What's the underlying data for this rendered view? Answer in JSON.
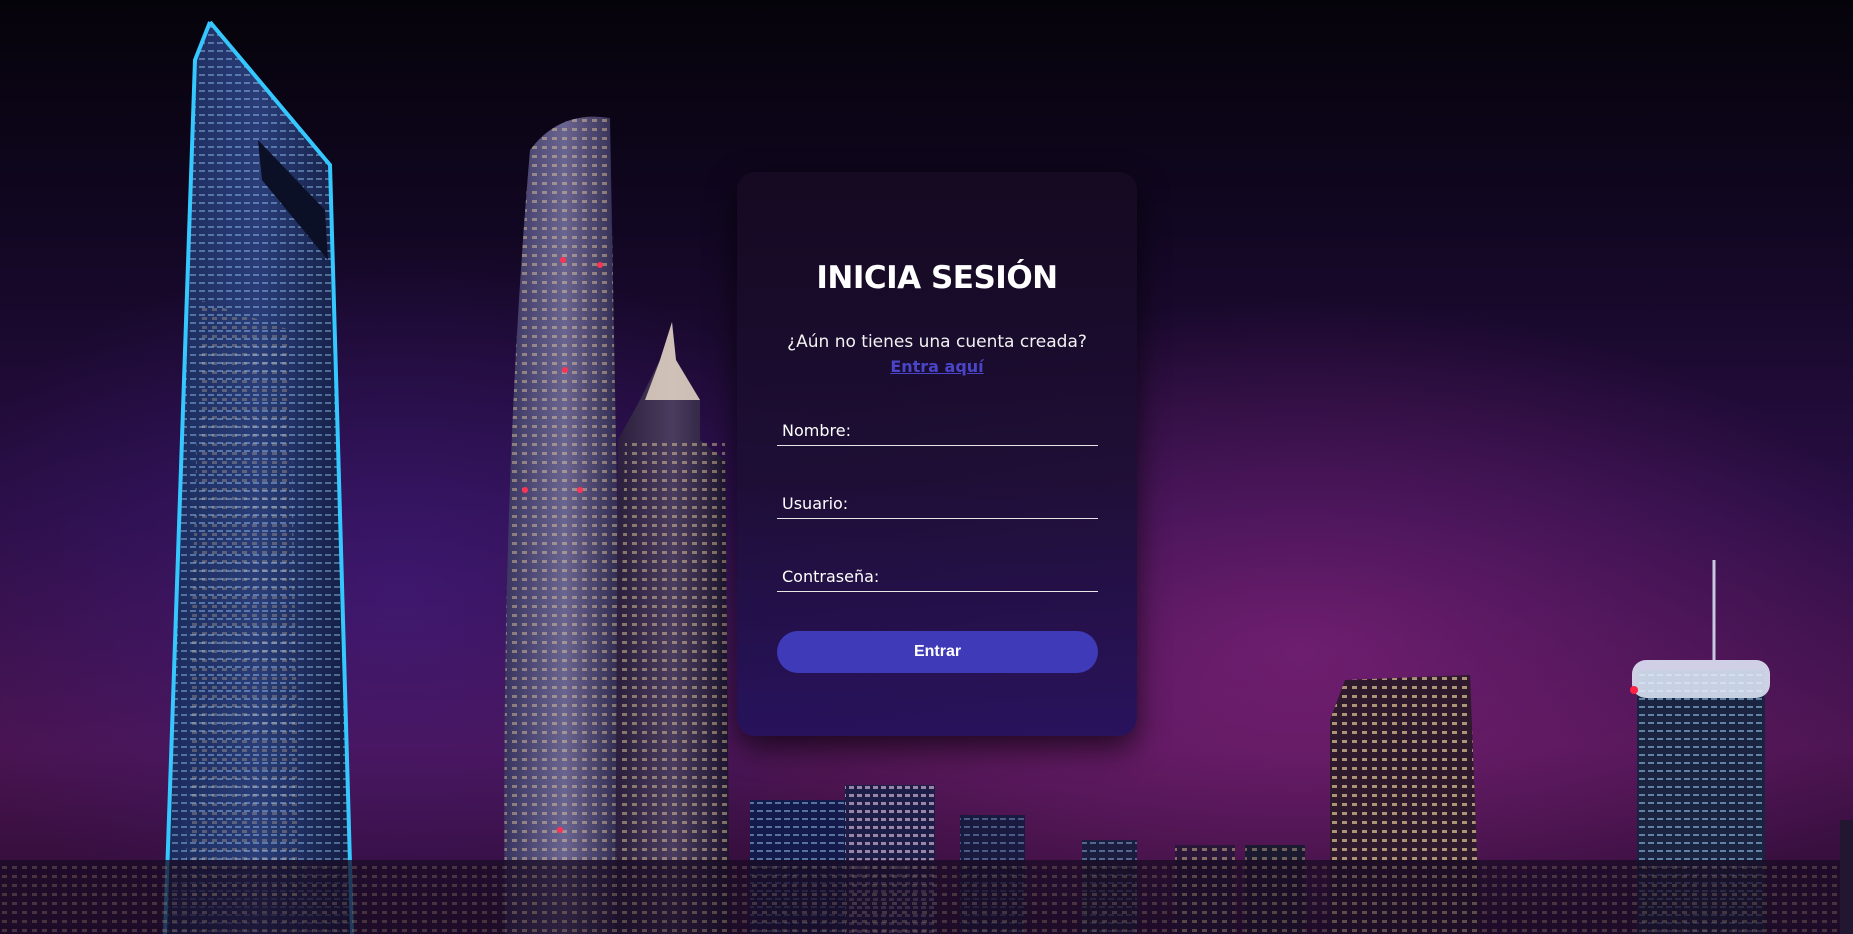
{
  "login": {
    "title": "INICIA SESIÓN",
    "subtitle": "¿Aún no tienes una cuenta creada?",
    "signup_link": "Entra aquí",
    "fields": [
      {
        "label": "Nombre:",
        "value": "",
        "placeholder": ""
      },
      {
        "label": "Usuario:",
        "value": "",
        "placeholder": ""
      },
      {
        "label": "Contraseña:",
        "value": "",
        "placeholder": ""
      }
    ],
    "submit_label": "Entrar"
  },
  "colors": {
    "accent": "#3f3bb8",
    "link": "#4a44c9",
    "card_background": "#1c0e34",
    "text": "#ffffff"
  },
  "background": {
    "description_icon": "city-skyline-night-image"
  }
}
